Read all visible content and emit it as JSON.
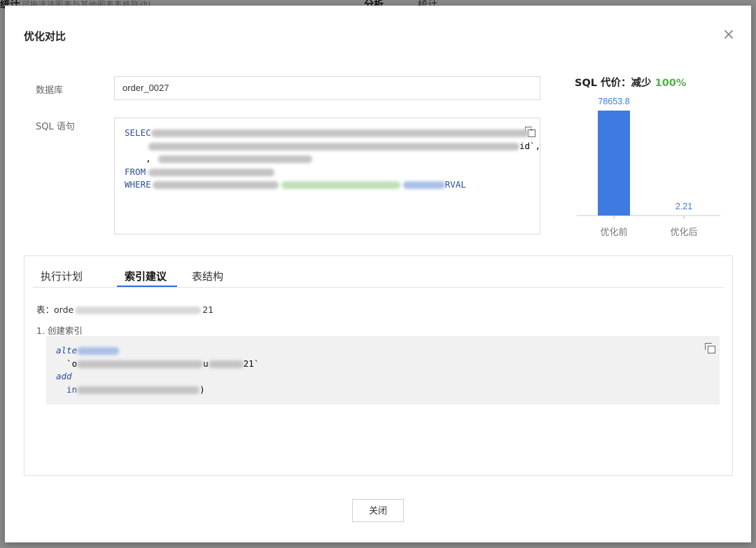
{
  "background": {
    "left_title": "统计",
    "left_subtitle": "(可拖选该图表与其他图表表格联动)",
    "right_title": "分析",
    "right_tab": "统计"
  },
  "modal": {
    "title": "优化对比",
    "close_label": "×",
    "footer_button": "关闭"
  },
  "form": {
    "database_label": "数据库",
    "database_value": "order_0027",
    "sql_label": "SQL 语句",
    "sql_fragments": {
      "line1_kw": "SELEC",
      "line1_tail": "`",
      "line2_tail": "id`,",
      "line3_lead": "    ,",
      "line4_kw": "FROM",
      "line5_kw": "WHERE",
      "line5_tail": "RVAL"
    }
  },
  "cost": {
    "title_prefix": "SQL 代价：减少",
    "reduction": "100%"
  },
  "chart_data": {
    "type": "bar",
    "categories": [
      "优化前",
      "优化后"
    ],
    "values": [
      78653.8,
      2.21
    ],
    "value_labels": [
      "78653.8",
      "2.21"
    ],
    "colors": [
      "#3f7ae3",
      "#3f7ae3"
    ],
    "label_color": "#3f7ae3",
    "title": "",
    "xlabel": "",
    "ylabel": ""
  },
  "tabs": [
    {
      "label": "执行计划",
      "active": false
    },
    {
      "label": "索引建议",
      "active": true
    },
    {
      "label": "表结构",
      "active": false
    }
  ],
  "index_advice": {
    "table_prefix": "表：orde",
    "table_suffix": "21",
    "step_label": "1. 创建索引",
    "code": {
      "line1": "alte",
      "line2_lead": "  `o",
      "line2_mid": "u",
      "line2_tail": "21`",
      "line3": "add",
      "line4_lead": "  in",
      "line4_tail": ")"
    }
  }
}
